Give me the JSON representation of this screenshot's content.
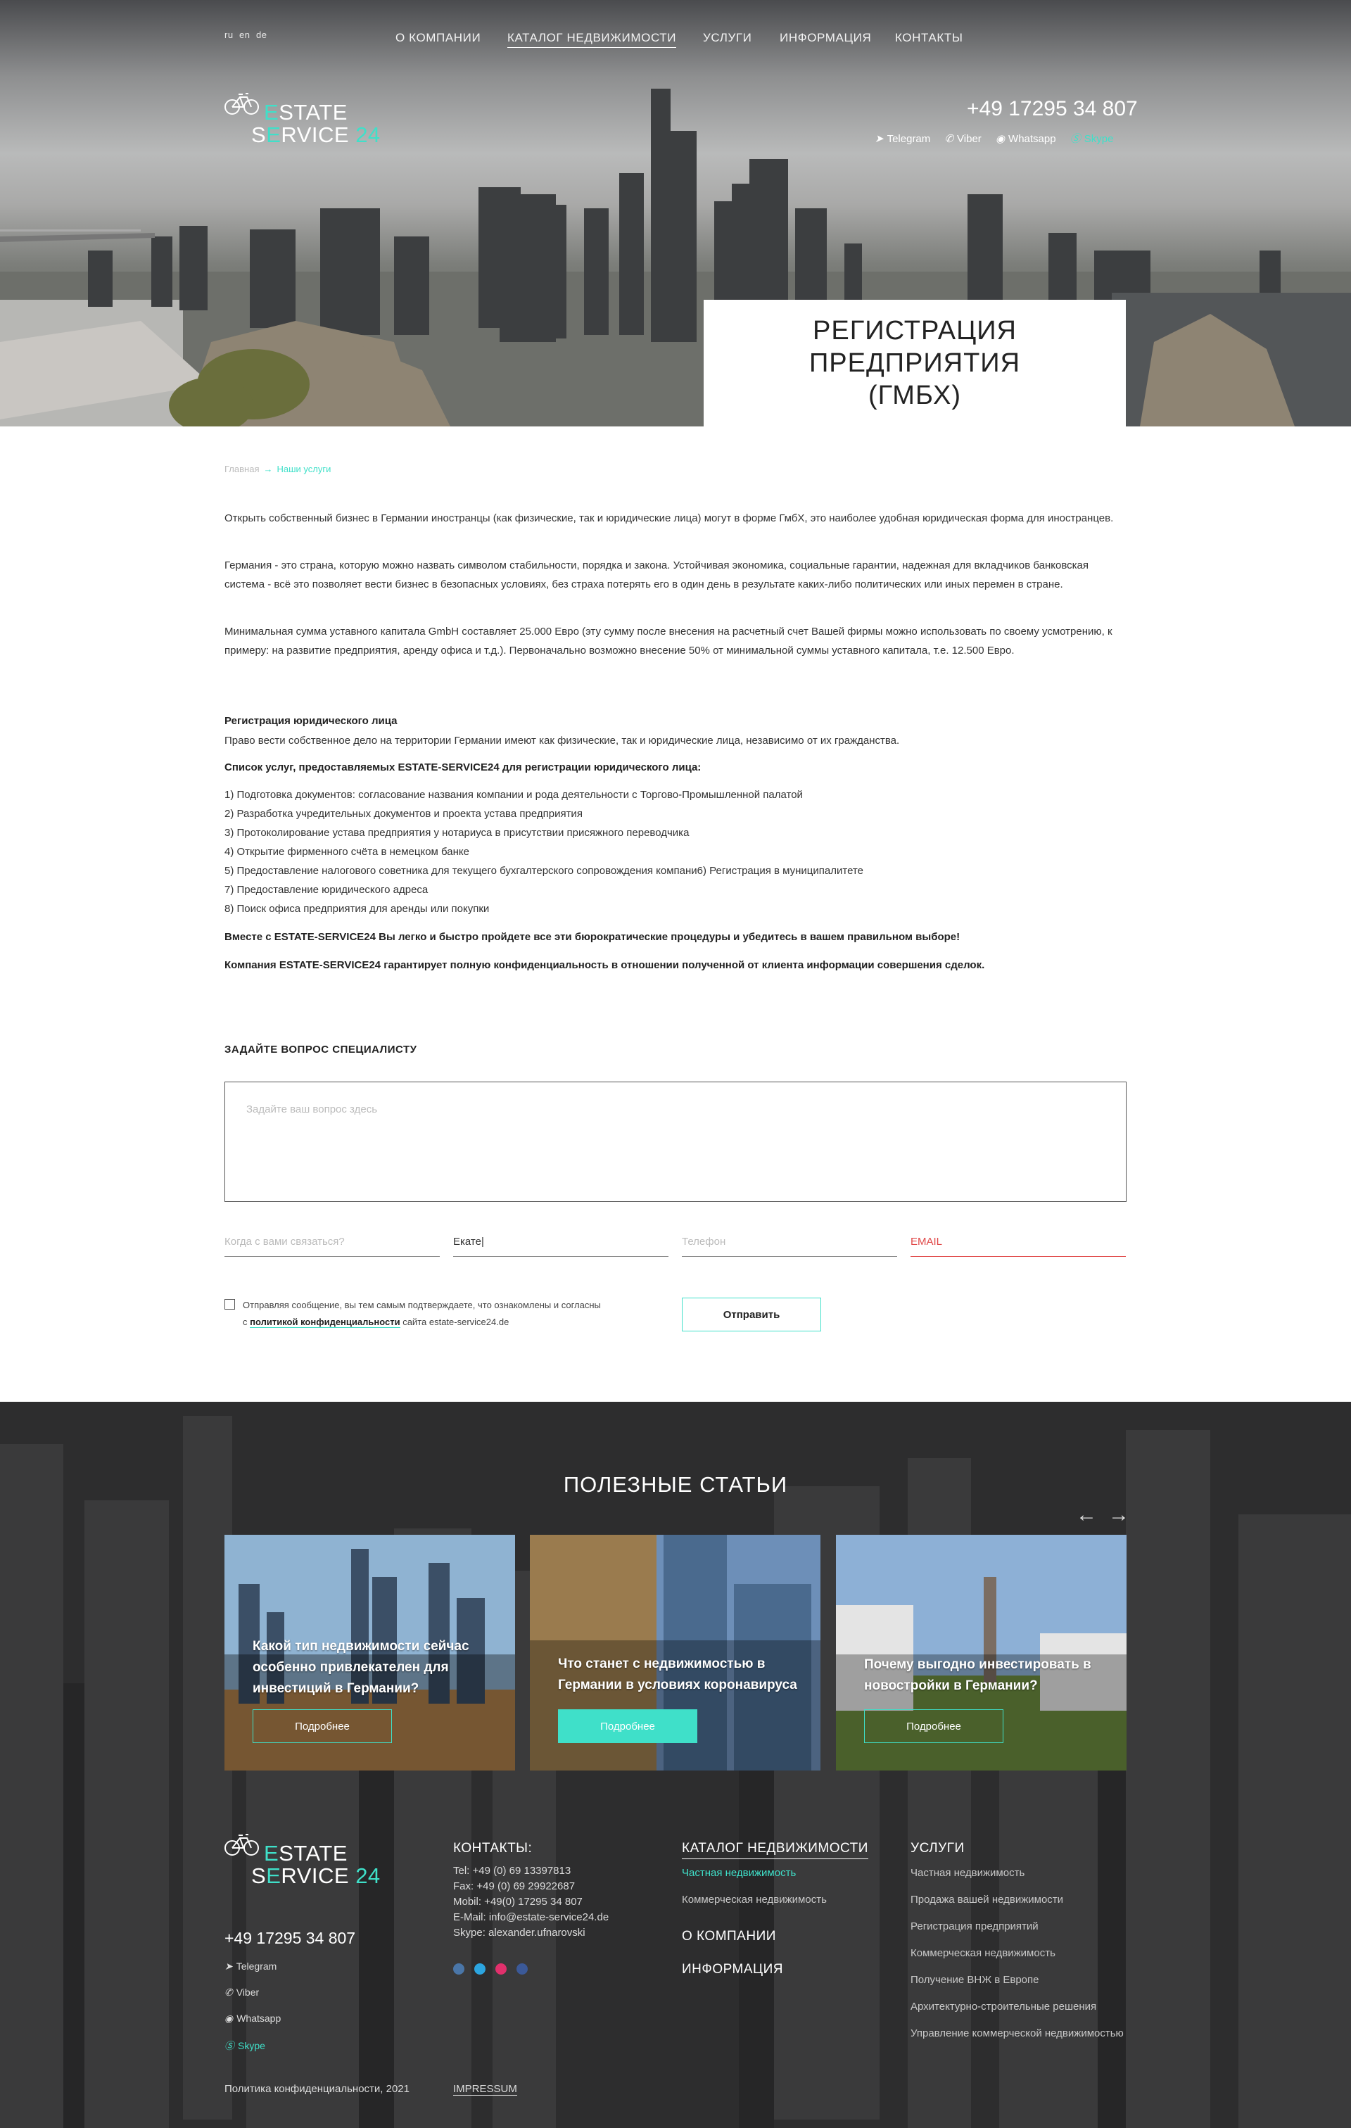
{
  "langs": [
    "ru",
    "en",
    "de"
  ],
  "nav": [
    "О КОМПАНИИ",
    "КАТАЛОГ НЕДВИЖИМОСТИ",
    "УСЛУГИ",
    "ИНФОРМАЦИЯ",
    "КОНТАКТЫ"
  ],
  "logo": {
    "line1_a": "E",
    "line1_b": "STATE",
    "line2_a": "S",
    "line2_b": "E",
    "line2_c": "RVICE",
    "line2_num": "24"
  },
  "header": {
    "phone": "+49 17295 34 807",
    "messengers": [
      "Telegram",
      "Viber",
      "Whatsapp",
      "Skype"
    ]
  },
  "page_title": "РЕГИСТРАЦИЯ\nПРЕДПРИЯТИЯ\n(ГМБХ)",
  "breadcrumb": {
    "home": "Главная",
    "arrow": "→",
    "current": "Наши услуги"
  },
  "intro": [
    "Открыть собственный бизнес в Германии иностранцы (как физические, так и юридические лица) могут в форме ГмбХ, это наиболее удобная юридическая форма для иностранцев.",
    "Германия - это страна, которую можно назвать символом стабильности, порядка и закона. Устойчивая экономика, социальные гарантии, надежная для вкладчиков банковская система - всё это позволяет вести бизнес в безопасных условиях, без страха потерять его в один день в результате каких-либо политических или иных перемен в стране.",
    "Минимальная сумма уставного капитала GmbH составляет 25.000 Евро (эту сумму после внесения на расчетный счет Вашей фирмы можно использовать по своему усмотрению, к примеру: на развитие предприятия, аренду офиса и т.д.). Первоначально возможно внесение 50% от минимальной суммы уставного капитала, т.е. 12.500 Евро."
  ],
  "reg_heading": "Регистрация юридического лица",
  "reg_text": "Право вести собственное дело на территории Германии имеют как физические, так и юридические лица, независимо от их гражданства.",
  "list_heading": "Список услуг, предоставляемых ESTATE-SERVICE24 для регистрации юридического лица:",
  "list": [
    "1) Подготовка документов: согласование названия компании и рода деятельности с Торгово-Промышленной палатой",
    "2) Разработка учредительных документов и проекта устава предприятия",
    "3) Протоколирование устава предприятия у нотариуса в присутствии присяжного переводчика",
    "4) Открытие фирменного счёта в немецком банке",
    "5) Предоставление налогового советника для текущего бухгалтерского сопровождения компани6) Регистрация в муниципалитете",
    "7) Предоставление юридического адреса",
    "8) Поиск офиса предприятия для аренды или покупки"
  ],
  "bold1": "Вместе с ESTATE-SERVICE24 Вы легко и быстро пройдете все эти бюрократические процедуры и убедитесь в вашем правильном выборе!",
  "bold2": "Компания ESTATE-SERVICE24 гарантирует полную конфиденциальность в отношении полученной от клиента информации совершения сделок.",
  "form": {
    "heading": "ЗАДАЙТЕ ВОПРОС СПЕЦИАЛИСТУ",
    "question_placeholder": "Задайте ваш вопрос здесь",
    "contact_placeholder": "Когда с вами связаться?",
    "name_value": "Екате|",
    "phone_placeholder": "Телефон",
    "email_placeholder": "EMAIL",
    "consent_1": "Отправляя сообщение, вы тем самым подтверждаете, что ознакомлены и согласны",
    "consent_2a": "с ",
    "consent_link": "политикой конфиденциальности",
    "consent_2b": " сайта estate-service24.de",
    "submit": "Отправить"
  },
  "articles": {
    "heading": "ПОЛЕЗНЫЕ СТАТЬИ",
    "prev": "←",
    "next": "→",
    "items": [
      {
        "title": "Какой тип недвижимости сейчас особенно привлекателен для инвестиций в Германии?",
        "button": "Подробнее"
      },
      {
        "title": "Что станет с недвижимостью в Германии в условиях коронавируса",
        "button": "Подробнее"
      },
      {
        "title": "Почему выгодно инвестировать в новостройки в Германии?",
        "button": "Подробнее"
      }
    ]
  },
  "footer": {
    "phone": "+49 17295 34 807",
    "messengers": [
      "Telegram",
      "Viber",
      "Whatsapp",
      "Skype"
    ],
    "contacts_heading": "КОНТАКТЫ:",
    "contacts": "Tel: +49 (0) 69 13397813\nFax: +49 (0) 69 29922687\nMobil: +49(0) 17295 34 807\nE-Mail: info@estate-service24.de\nSkype: alexander.ufnarovski",
    "catalog_heading": "КАТАЛОГ НЕДВИЖИМОСТИ",
    "catalog_links": [
      "Частная недвижимость",
      "Коммерческая недвижимость"
    ],
    "about": "О КОМПАНИИ",
    "info": "ИНФОРМАЦИЯ",
    "services_heading": "УСЛУГИ",
    "services_links": [
      "Частная недвижимость",
      "Продажа вашей недвижимости",
      "Регистрация предприятий",
      "Коммерческая недвижимость",
      "Получение ВНЖ в Европе",
      "Архитектурно-строительные решения",
      "Управление коммерческой недвижимостью"
    ],
    "policy": "Политика конфиденциальности, 2021",
    "impressum": "IMPRESSUM"
  },
  "colors": {
    "accent": "#3fe0c9",
    "dark_bg": "#2d2d2e",
    "error": "#e04848"
  }
}
